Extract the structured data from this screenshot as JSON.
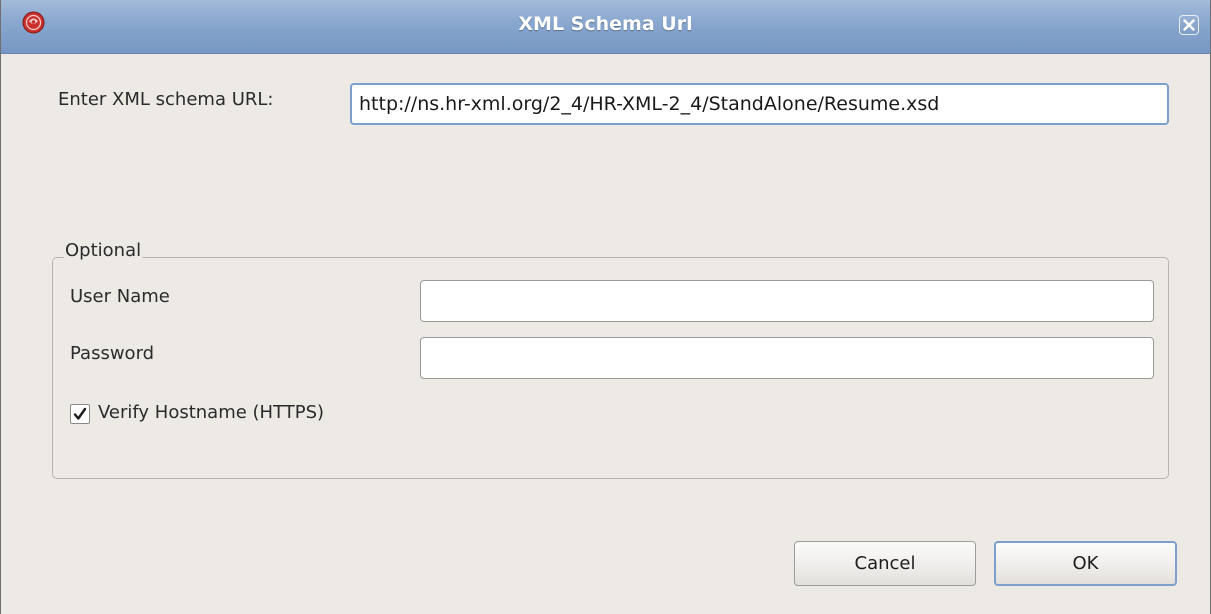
{
  "window": {
    "title": "XML Schema Url",
    "icons": {
      "app": "app-logo-icon",
      "close": "close-icon"
    }
  },
  "schema_url": {
    "label": "Enter XML schema URL:",
    "value": "http://ns.hr-xml.org/2_4/HR-XML-2_4/StandAlone/Resume.xsd"
  },
  "optional": {
    "legend": "Optional",
    "username": {
      "label": "User Name",
      "value": ""
    },
    "password": {
      "label": "Password",
      "value": ""
    },
    "verify_hostname": {
      "label": "Verify Hostname (HTTPS)",
      "checked": true
    }
  },
  "buttons": {
    "cancel": "Cancel",
    "ok": "OK"
  },
  "colors": {
    "titlebar": "#8aa8cf",
    "dialog_bg": "#edeae6",
    "focus_border": "#7c9fcc"
  }
}
